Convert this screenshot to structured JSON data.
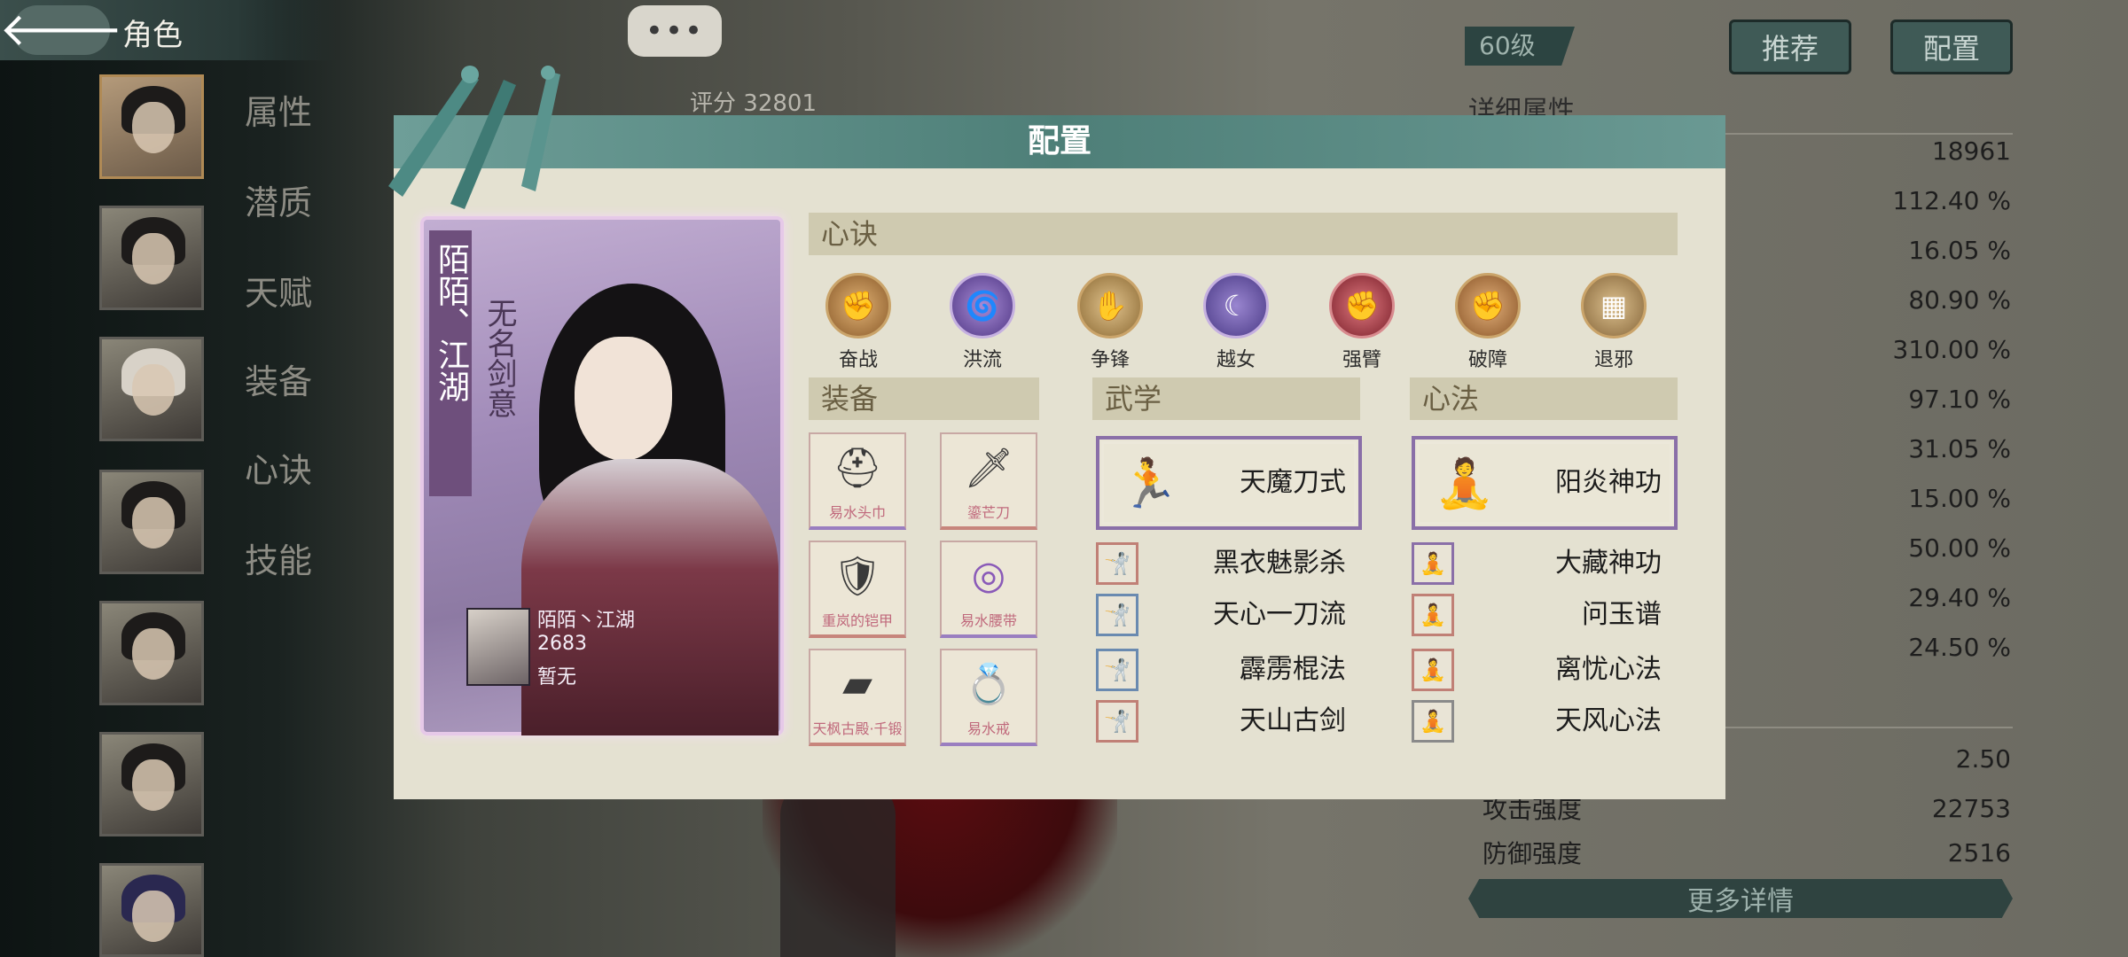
{
  "topbar": {
    "back_glyph": "🡐",
    "title": "角色",
    "chat_glyph": "•••"
  },
  "score": {
    "label": "评分",
    "value": "32801"
  },
  "tabs": [
    "属性",
    "潜质",
    "天赋",
    "装备",
    "心诀",
    "技能"
  ],
  "right_panel": {
    "level": "60级",
    "recommend_label": "推荐",
    "config_label": "配置",
    "detail_title": "详细属性",
    "stats": [
      "18961",
      "112.40 %",
      "16.05 %",
      "80.90 %",
      "310.00 %",
      "97.10 %",
      "31.05 %",
      "15.00 %",
      "50.00 %",
      "29.40 %",
      "24.50 %"
    ],
    "bottom_stats": [
      {
        "label": "",
        "value": "2.50"
      },
      {
        "label": "攻击强度",
        "value": "22753"
      },
      {
        "label": "防御强度",
        "value": "2516"
      }
    ],
    "more_label": "更多详情"
  },
  "modal": {
    "title": "配置",
    "card": {
      "name": "陌陌、江湖",
      "subtitle": "无名剑意",
      "info_name": "陌陌丶江湖",
      "info_power": "2683",
      "info_status": "暂无"
    },
    "xinjue": {
      "title": "心诀",
      "items": [
        {
          "label": "奋战",
          "glyph": "✊",
          "color": "#c58a4a"
        },
        {
          "label": "洪流",
          "glyph": "🌀",
          "color": "#7a5aa8"
        },
        {
          "label": "争锋",
          "glyph": "✋",
          "color": "#b99255"
        },
        {
          "label": "越女",
          "glyph": "☾",
          "color": "#7b66b0"
        },
        {
          "label": "强臂",
          "glyph": "✊",
          "color": "#b2454e"
        },
        {
          "label": "破障",
          "glyph": "✊",
          "color": "#b8864e"
        },
        {
          "label": "退邪",
          "glyph": "▦",
          "color": "#b18f62"
        }
      ]
    },
    "equipment": {
      "title": "装备",
      "items": [
        {
          "label": "易水头巾",
          "glyph": "⛑",
          "tier": "purple"
        },
        {
          "label": "鎏芒刀",
          "glyph": "🗡",
          "tier": "red"
        },
        {
          "label": "重岚的铠甲",
          "glyph": "🛡",
          "tier": "red"
        },
        {
          "label": "易水腰带",
          "glyph": "◎",
          "tier": "purple"
        },
        {
          "label": "天枫古殿·千锻",
          "glyph": "▰",
          "tier": "red"
        },
        {
          "label": "易水戒",
          "glyph": "💍",
          "tier": "purple"
        }
      ]
    },
    "wuxue": {
      "title": "武学",
      "main": {
        "name": "天魔刀式",
        "glyph": "🏃"
      },
      "skills": [
        {
          "name": "黑衣魅影杀",
          "glyph": "🤺",
          "border": "#c08076"
        },
        {
          "name": "天心一刀流",
          "glyph": "🤺",
          "border": "#6a8ab0"
        },
        {
          "name": "霹雳棍法",
          "glyph": "🤺",
          "border": "#6a8ab0"
        },
        {
          "name": "天山古剑",
          "glyph": "🤺",
          "border": "#c08076"
        }
      ]
    },
    "xinfa": {
      "title": "心法",
      "main": {
        "name": "阳炎神功",
        "glyph": "🧘"
      },
      "skills": [
        {
          "name": "大藏神功",
          "glyph": "🧘",
          "border": "#8a6fa8"
        },
        {
          "name": "问玉谱",
          "glyph": "🧘",
          "border": "#c08076"
        },
        {
          "name": "离忧心法",
          "glyph": "🧘",
          "border": "#c08076"
        },
        {
          "name": "天风心法",
          "glyph": "🧘",
          "border": "#8a8a8a"
        }
      ]
    }
  }
}
